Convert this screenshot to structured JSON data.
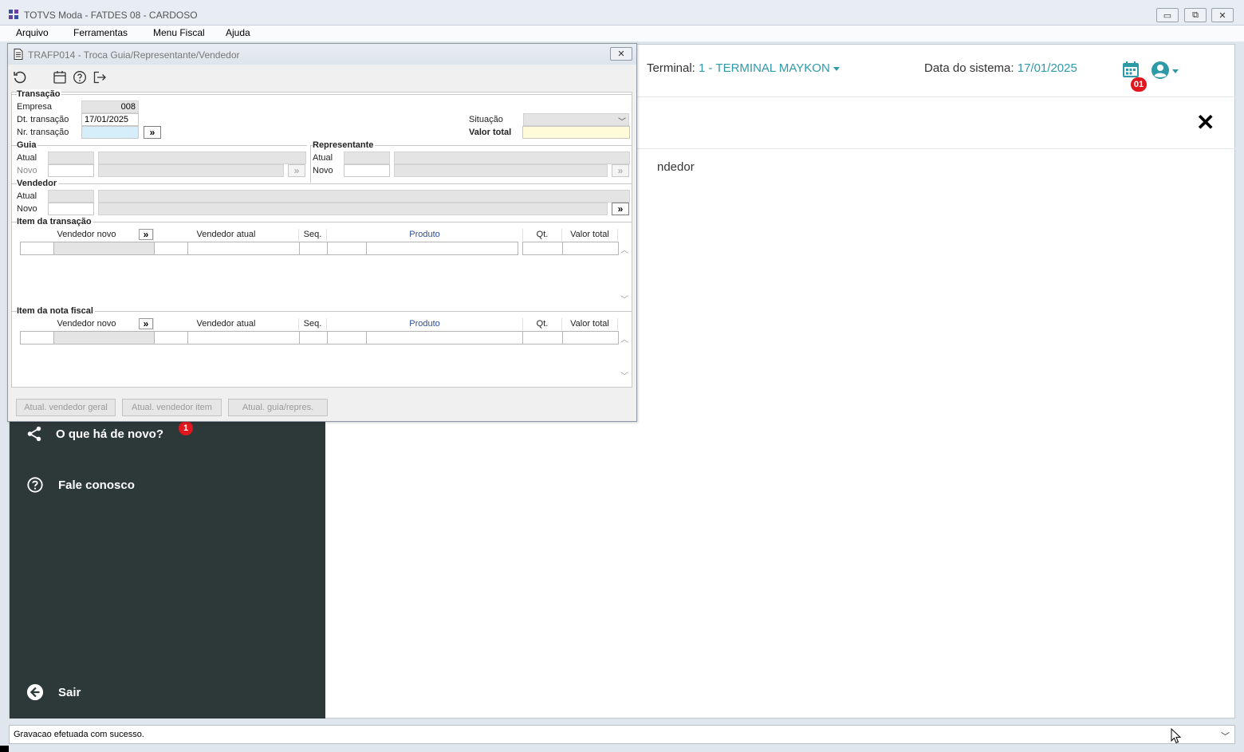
{
  "app": {
    "title": "TOTVS Moda - FATDES 08 - CARDOSO",
    "window_buttons": {
      "minimize": "▭",
      "restore": "⧉",
      "close": "✕"
    }
  },
  "menu": [
    {
      "label": "Arquivo"
    },
    {
      "label": "Ferramentas"
    },
    {
      "label": "Menu Fiscal"
    },
    {
      "label": "Ajuda"
    }
  ],
  "header": {
    "terminal_label": "Terminal:",
    "terminal_value": "1 - TERMINAL MAYKON",
    "sysdate_label": "Data do sistema:",
    "sysdate_value": "17/01/2025",
    "calendar_badge": "01",
    "close_symbol": "✕"
  },
  "background_text": "ndedor",
  "sidebar": {
    "items": [
      {
        "label": "O que há de novo?",
        "badge": "1",
        "icon": "share-icon"
      },
      {
        "label": "Fale conosco",
        "icon": "help-circle-icon"
      },
      {
        "label": "Sair",
        "icon": "arrow-left-circle-icon"
      }
    ]
  },
  "status": {
    "text": "Gravacao efetuada com sucesso."
  },
  "modal": {
    "title": "TRAFP014 - Troca Guia/Representante/Vendedor",
    "close": "✕",
    "transacao": {
      "legend": "Transação",
      "empresa_label": "Empresa",
      "empresa_value": "008",
      "dt_label": "Dt. transação",
      "dt_value": "17/01/2025",
      "nr_label": "Nr. transação",
      "nr_value": "",
      "situacao_label": "Situação",
      "valor_total_label": "Valor total"
    },
    "guia": {
      "legend": "Guia",
      "atual_label": "Atual",
      "novo_label": "Novo"
    },
    "representante": {
      "legend": "Representante",
      "atual_label": "Atual",
      "novo_label": "Novo"
    },
    "vendedor": {
      "legend": "Vendedor",
      "atual_label": "Atual",
      "novo_label": "Novo"
    },
    "more_symbol": "»",
    "item_transacao": {
      "legend": "Item da transação",
      "columns": [
        "Vendedor novo",
        "Vendedor atual",
        "Seq.",
        "Produto",
        "Qt.",
        "Valor total"
      ]
    },
    "item_nota": {
      "legend": "Item da nota fiscal",
      "columns": [
        "Vendedor novo",
        "Vendedor atual",
        "Seq.",
        "Produto",
        "Qt.",
        "Valor total"
      ]
    },
    "buttons": {
      "atual_vendedor_geral": "Atual. vendedor geral",
      "atual_vendedor_item": "Atual. vendedor item",
      "atual_guia_repres": "Atual. guia/repres."
    }
  }
}
